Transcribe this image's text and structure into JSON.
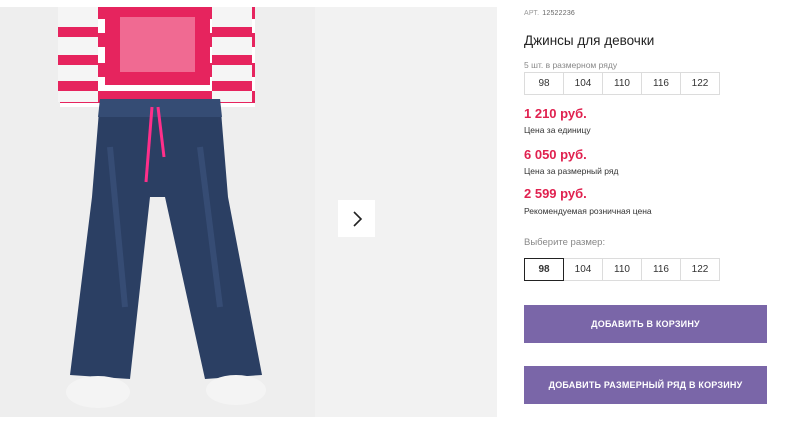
{
  "product": {
    "sku_label": "АРТ.",
    "sku_value": "12522236",
    "title": "Джинсы для девочки",
    "pack_note": "5 шт. в размерном ряду",
    "pack_sizes": [
      "98",
      "104",
      "110",
      "116",
      "122"
    ]
  },
  "prices": [
    {
      "value": "1 210 руб.",
      "label": "Цена за единицу"
    },
    {
      "value": "6 050 руб.",
      "label": "Цена за размерный ряд"
    },
    {
      "value": "2 599 руб.",
      "label": "Рекомендуемая розничная цена"
    }
  ],
  "size_picker": {
    "label": "Выберите размер:",
    "sizes": [
      "98",
      "104",
      "110",
      "116",
      "122"
    ],
    "selected": "98"
  },
  "buttons": {
    "add_to_cart": "ДОБАВИТЬ В КОРЗИНУ",
    "add_pack_to_cart": "ДОБАВИТЬ РАЗМЕРНЫЙ РЯД В КОРЗИНУ"
  },
  "gallery": {
    "next_icon": "chevron-right-icon"
  },
  "colors": {
    "price": "#e0214f",
    "button": "#7a66a8",
    "denim": "#2b3f63",
    "sweater_pink": "#e6245e"
  }
}
